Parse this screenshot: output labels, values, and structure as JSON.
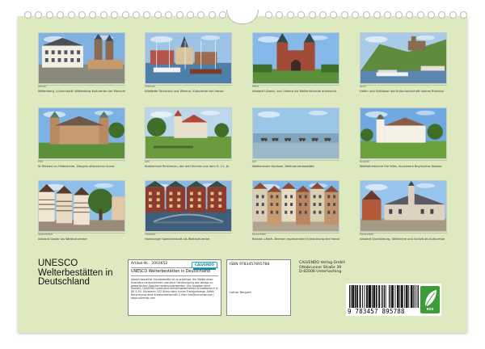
{
  "photos": [
    {
      "month": "Januar",
      "caption": "Wittenberg, Lutherstadt: Wittenberg-Kulturerbe der Menschheit",
      "scene": "townhall",
      "sky": "#7fb2e0"
    },
    {
      "month": "Februar",
      "caption": "Altstädte Stralsund und Wismar, Kulturerbe der Hanse",
      "scene": "harbor",
      "sky": "#9cc3e6"
    },
    {
      "month": "März",
      "caption": "Altstadt Lübeck, von Unesco als Weltkulturerbe anerkannt",
      "scene": "gate",
      "sky": "#86b8e8"
    },
    {
      "month": "April",
      "caption": "Hafen und Schlösser der Kulturlandschaft oberes Rheintal",
      "scene": "castle",
      "sky": "#a8cce8"
    },
    {
      "month": "Mai",
      "caption": "St.Michael zu Hildesheim, Zeugnis ottonischer Kunst",
      "scene": "church",
      "sky": "#7db3e4"
    },
    {
      "month": "Juni",
      "caption": "Klosterinsel Reichenau, die drei Kirchen aus dem 9.-11. Jh.",
      "scene": "monastery",
      "sky": "#bcd6ec"
    },
    {
      "month": "Juli",
      "caption": "Wattenmeer Nordsee, Weltnaturerbestätte",
      "scene": "watt",
      "sky": "#9ac6e8"
    },
    {
      "month": "August",
      "caption": "Wallfahrtskirche Die Wies, Kunstwerk Bayrisches Rokoko",
      "scene": "wies",
      "sky": "#6fa9e0"
    },
    {
      "month": "September",
      "caption": "Altstadt Goslar als Weltkulturerbe",
      "scene": "timber",
      "sky": "#8ebfe9"
    },
    {
      "month": "Oktober",
      "caption": "Hamburger Speicherstadt als Weltkulturerbe",
      "scene": "speicher",
      "sky": "#8db7df"
    },
    {
      "month": "November",
      "caption": "Roland u.Rath. Bremen repräsentiert Entwicklung der Hanse",
      "scene": "bremen",
      "sky": "#80b4e4"
    },
    {
      "month": "Dezember",
      "caption": "Altstadt Quedlinburg, Stiftkirche und Schloß als Kulturerbe",
      "scene": "quedlinburg",
      "sky": "#98c3ea"
    }
  ],
  "title": {
    "line1": "UNESCO",
    "line2": "Welterbestätten in",
    "line3": "Deutschland"
  },
  "info": {
    "article_number": "Artikel-Nr.: 2003652",
    "product_title": "UNESCO Welterbestätten in Deutschland",
    "description": "Adolph beautifulr Schalbestellte ist so prächtige, die Städte diese Kalenders herausnehmen und ohne Genehmigung des Verlags zu gewerblichen Zwecken weiterzuverwenden. Alle Angaben ohne Gewähr. CALVENDO produziert berhalhigesomeerde Artukelbereich in DE & EU. Rückwenn CO2 Bilanz dank kurzer Transportwege. Abfall-Recyclerung dank Kreislaufwirtschaft. E-Mail: info@calvendo.com / www.calvendo.com",
    "logo_label": "CALVENDO"
  },
  "isbn": {
    "label": "ISBN 9783457895788",
    "author": "Lothar Reupert"
  },
  "publisher": {
    "name": "CALVENDO Verlag GmbH",
    "street": "Ottobrunner Straße 39",
    "city": "D-82008 Unterhaching"
  },
  "barcode": {
    "digits": "9 783457 895788"
  },
  "eco": {
    "label": "eco"
  },
  "colors": {
    "sheet": "#dde9bf",
    "accent": "#3c9b3a",
    "logo": "#1b86a6"
  }
}
